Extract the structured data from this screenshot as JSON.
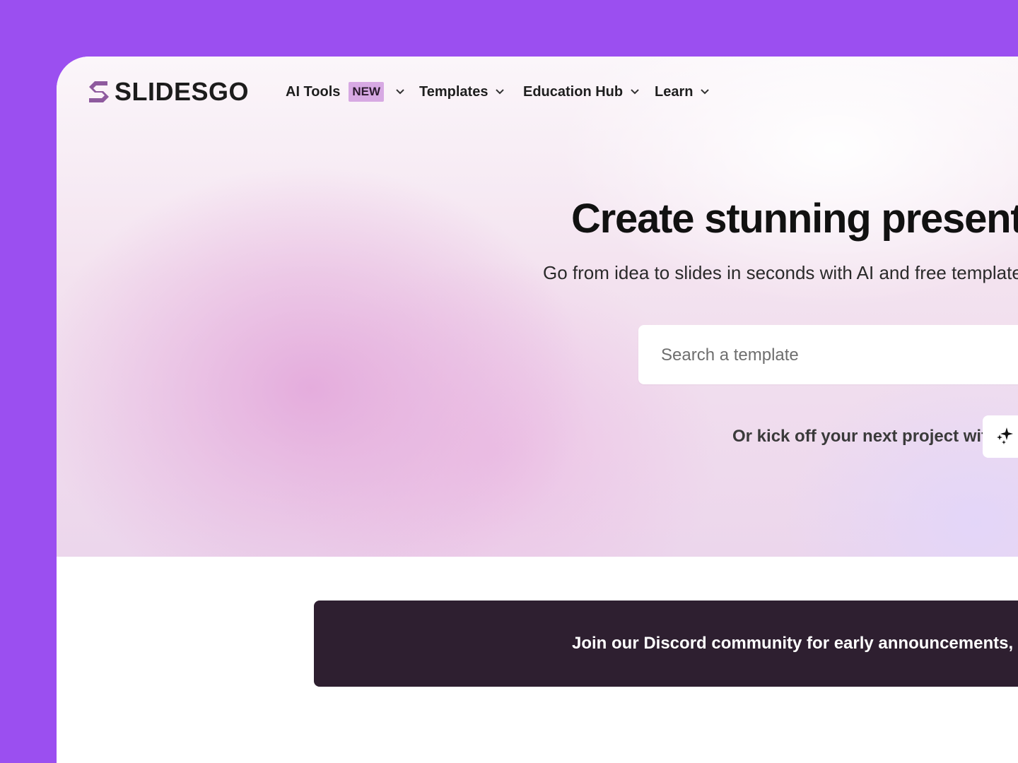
{
  "nav": {
    "logo_text": "SLIDESGO",
    "items": [
      {
        "label": "AI Tools",
        "badge": "NEW"
      },
      {
        "label": "Templates"
      },
      {
        "label": "Education Hub"
      },
      {
        "label": "Learn"
      }
    ]
  },
  "hero": {
    "headline": "Create stunning presentat",
    "subhead": "Go from idea to slides in seconds with AI and free templates",
    "search": {
      "placeholder": "Search a template",
      "value": ""
    },
    "kickoff_text": "Or kick off your next project with",
    "ai_chip_icon": "sparkle-icon"
  },
  "banner": {
    "text": "Join our Discord community for early announcements, specia"
  },
  "colors": {
    "outer_background": "#9b4ff0",
    "badge_background": "#d7a9e3",
    "banner_background": "#2e1f30",
    "logo_mark": "#8e5a9e"
  }
}
